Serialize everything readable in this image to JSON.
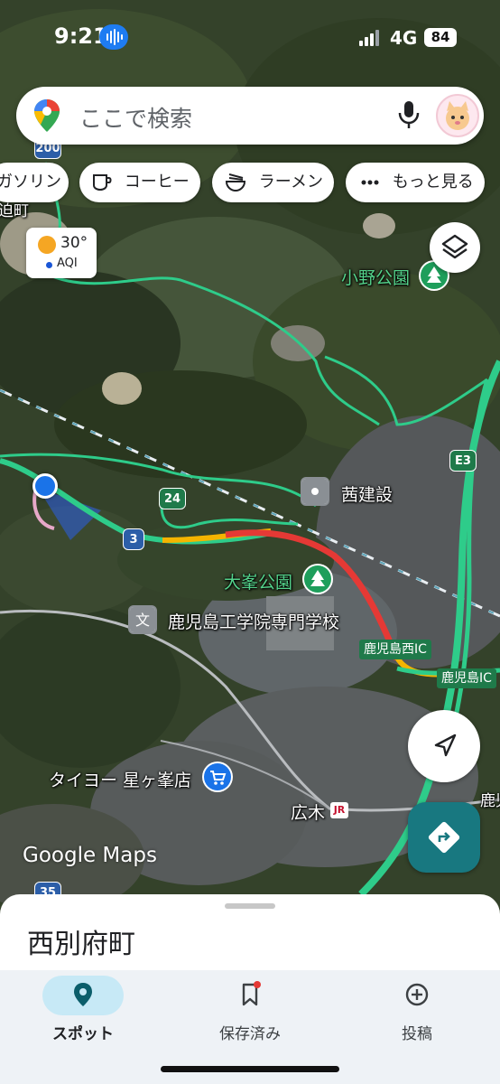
{
  "status": {
    "time": "9:21",
    "network": "4G",
    "battery": "84"
  },
  "search": {
    "placeholder": "ここで検索"
  },
  "chips": [
    {
      "label": "ガソリン",
      "icon": "gas-icon"
    },
    {
      "label": "コーヒー",
      "icon": "coffee-icon"
    },
    {
      "label": "ラーメン",
      "icon": "ramen-icon"
    },
    {
      "label": "もっと見る",
      "icon": "more-icon"
    }
  ],
  "weather": {
    "temp": "30°",
    "aqi": "AQI"
  },
  "map": {
    "labels": {
      "town_fragment": "迫町",
      "ono_park": "小野公園",
      "akane": "茜建設",
      "omine_park": "大峯公園",
      "school": "鹿児島工学院専門学校",
      "kagoshima_nishi_ic": "鹿児島西IC",
      "kagoshima_ic": "鹿児島IC",
      "taiyo": "タイヨー 星ヶ峯店",
      "hiroki": "広木",
      "edge_fragment": "鹿児"
    },
    "route_badges": {
      "r200": "200",
      "r24": "24",
      "r3": "3",
      "e3": "E3",
      "r35": "35"
    },
    "jr_mark": "JR",
    "logo": "Google Maps"
  },
  "sheet": {
    "place_name": "西別府町"
  },
  "nav": [
    {
      "label": "スポット",
      "icon": "location-pin-icon",
      "active": true
    },
    {
      "label": "保存済み",
      "icon": "bookmark-icon",
      "active": false
    },
    {
      "label": "投稿",
      "icon": "plus-circle-icon",
      "active": false
    }
  ],
  "colors": {
    "accent": "#187880",
    "traffic_red": "#e53935",
    "traffic_yellow": "#f4b400",
    "road_green": "#2ecc8a"
  }
}
